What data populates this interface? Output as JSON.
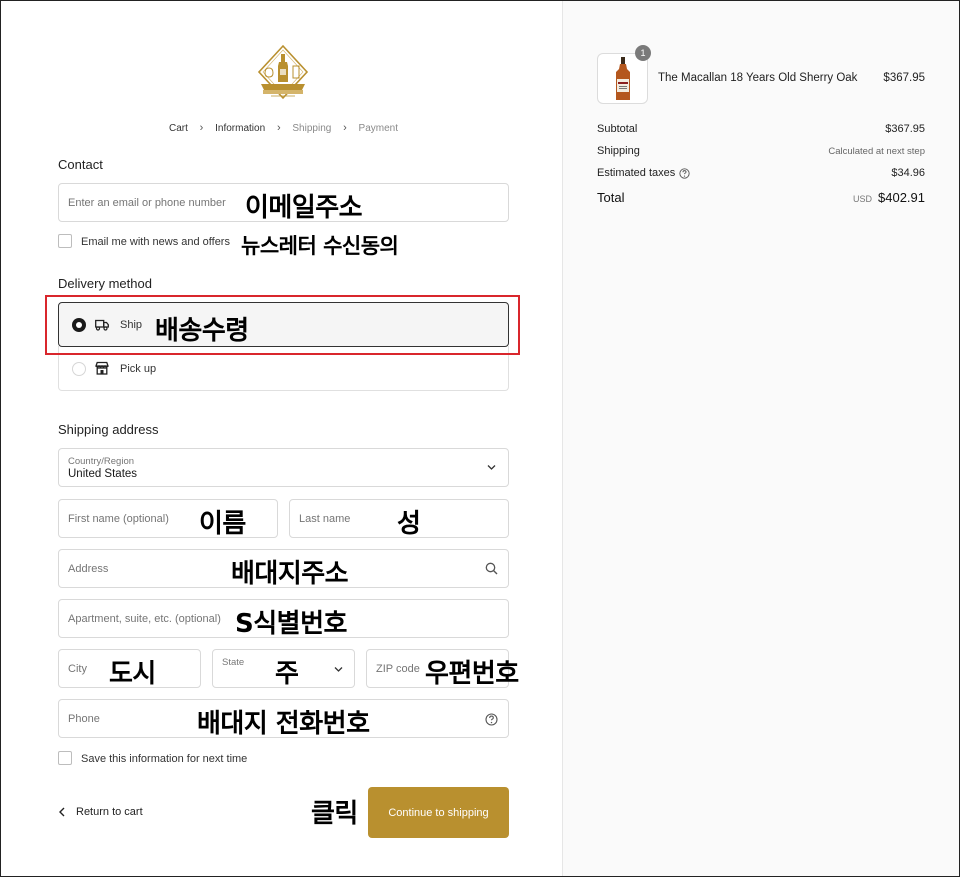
{
  "breadcrumb": {
    "cart": "Cart",
    "information": "Information",
    "shipping": "Shipping",
    "payment": "Payment"
  },
  "contact": {
    "title": "Contact",
    "email_placeholder": "Enter an email or phone number",
    "email_annotation": "이메일주소",
    "newsletter_label": "Email me with news and offers",
    "newsletter_annotation": "뉴스레터 수신동의"
  },
  "delivery": {
    "title": "Delivery method",
    "ship_label": "Ship",
    "ship_annotation": "배송수령",
    "pickup_label": "Pick up",
    "selected": "ship"
  },
  "shipping_address": {
    "title": "Shipping address",
    "country_label": "Country/Region",
    "country_value": "United States",
    "first_name_placeholder": "First name (optional)",
    "first_name_annotation": "이름",
    "last_name_placeholder": "Last name",
    "last_name_annotation": "성",
    "address_placeholder": "Address",
    "address_annotation": "배대지주소",
    "apartment_placeholder": "Apartment, suite, etc. (optional)",
    "apartment_annotation": "S식별번호",
    "city_placeholder": "City",
    "city_annotation": "도시",
    "state_label": "State",
    "state_annotation": "주",
    "zip_placeholder": "ZIP code",
    "zip_annotation": "우편번호",
    "phone_placeholder": "Phone",
    "phone_annotation": "배대지 전화번호",
    "save_info_label": "Save this information for next time"
  },
  "footer": {
    "return_label": "Return to cart",
    "click_annotation": "클릭",
    "continue_label": "Continue to shipping"
  },
  "summary": {
    "item_name": "The Macallan 18 Years Old Sherry Oak",
    "item_price": "$367.95",
    "item_qty": "1",
    "subtotal_label": "Subtotal",
    "subtotal_value": "$367.95",
    "shipping_label": "Shipping",
    "shipping_value": "Calculated at next step",
    "taxes_label": "Estimated taxes",
    "taxes_value": "$34.96",
    "total_label": "Total",
    "currency": "USD",
    "total_value": "$402.91"
  },
  "colors": {
    "accent": "#b9902f",
    "highlight_box": "#d9262c",
    "summary_bg": "#fafafa"
  },
  "icons": {
    "chevron": "chevron-right-icon",
    "truck": "truck-icon",
    "store": "store-icon",
    "search": "search-icon",
    "help": "help-circle-icon"
  }
}
